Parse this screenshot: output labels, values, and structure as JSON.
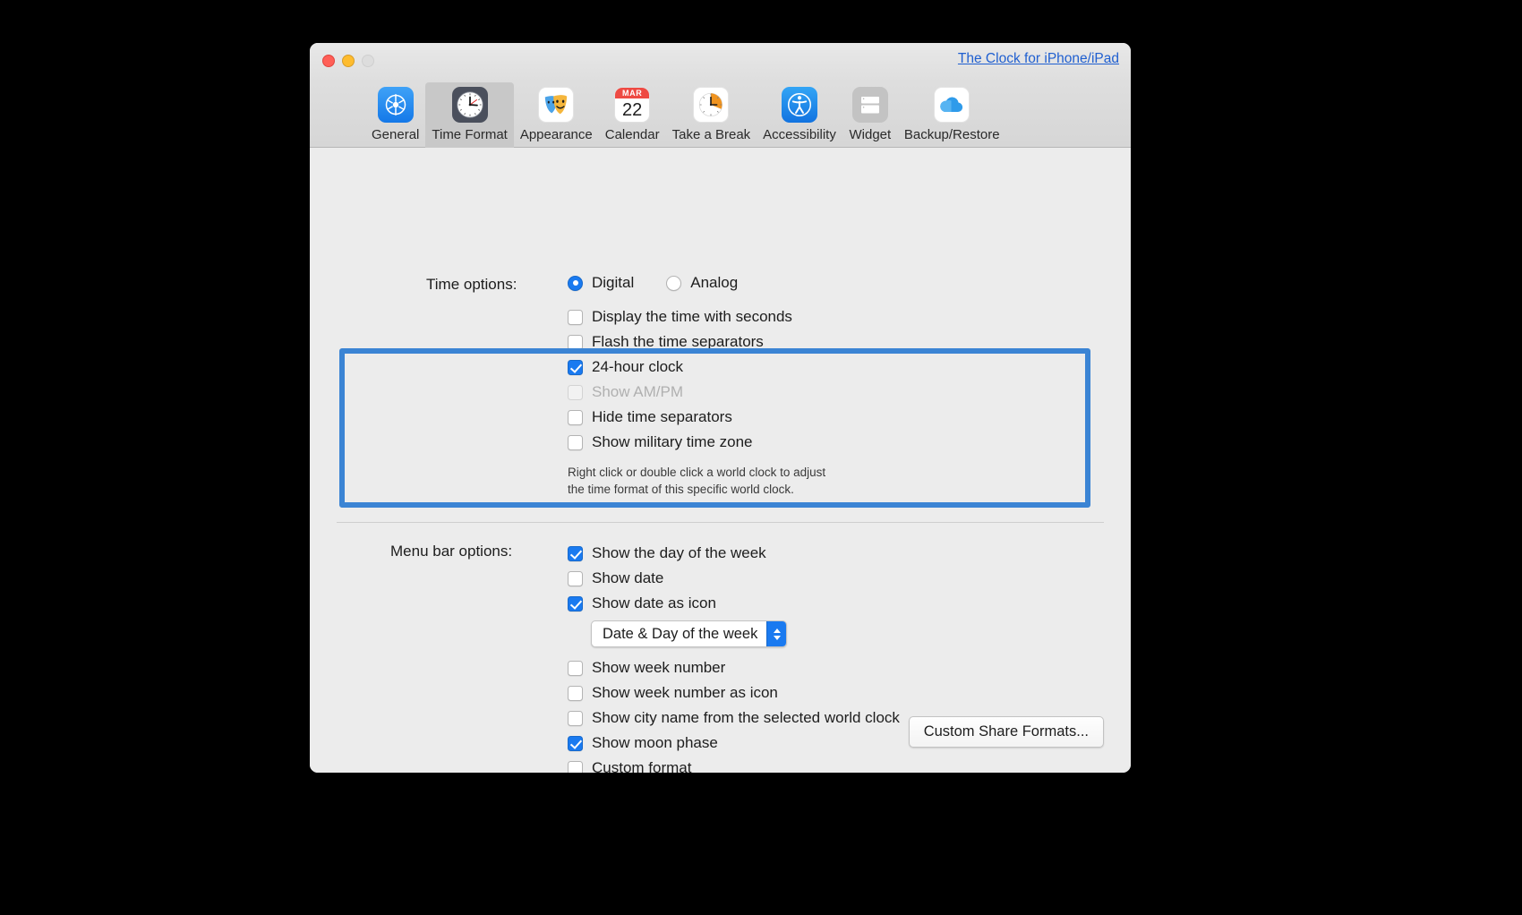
{
  "window": {
    "traffic_lights": [
      "close",
      "minimize",
      "zoom"
    ],
    "promo_link": "The Clock for iPhone/iPad"
  },
  "toolbar": {
    "items": [
      {
        "label": "General",
        "icon": "gear-icon",
        "selected": false
      },
      {
        "label": "Time Format",
        "icon": "clock-icon",
        "selected": true
      },
      {
        "label": "Appearance",
        "icon": "theater-masks-icon",
        "selected": false
      },
      {
        "label": "Calendar",
        "icon": "calendar-icon",
        "selected": false
      },
      {
        "label": "Take a Break",
        "icon": "timer-icon",
        "selected": false
      },
      {
        "label": "Accessibility",
        "icon": "accessibility-icon",
        "selected": false
      },
      {
        "label": "Widget",
        "icon": "widget-icon",
        "selected": false
      },
      {
        "label": "Backup/Restore",
        "icon": "cloud-icon",
        "selected": false
      }
    ],
    "calendar_icon": {
      "month": "MAR",
      "day": "22"
    }
  },
  "time_options": {
    "label": "Time options:",
    "radios": [
      {
        "label": "Digital",
        "selected": true
      },
      {
        "label": "Analog",
        "selected": false
      }
    ],
    "checkboxes": [
      {
        "label": "Display the time with seconds",
        "checked": false,
        "disabled": false
      },
      {
        "label": "Flash the time separators",
        "checked": false,
        "disabled": false
      },
      {
        "label": "24-hour clock",
        "checked": true,
        "disabled": false
      },
      {
        "label": "Show AM/PM",
        "checked": false,
        "disabled": true
      },
      {
        "label": "Hide time separators",
        "checked": false,
        "disabled": false
      },
      {
        "label": "Show military time zone",
        "checked": false,
        "disabled": false
      }
    ],
    "hint_line1": "Right click or double click a world clock to adjust",
    "hint_line2": "the time format of this specific world clock."
  },
  "menu_bar_options": {
    "label": "Menu bar options:",
    "checkboxes_top": [
      {
        "label": "Show the day of the week",
        "checked": true
      },
      {
        "label": "Show date",
        "checked": false
      },
      {
        "label": "Show date as icon",
        "checked": true
      }
    ],
    "date_format_popup": {
      "value": "Date & Day of the week"
    },
    "checkboxes_bottom": [
      {
        "label": "Show week number",
        "checked": false
      },
      {
        "label": "Show week number as icon",
        "checked": false
      },
      {
        "label": "Show city name from the selected world clock",
        "checked": false
      },
      {
        "label": "Show moon phase",
        "checked": true
      },
      {
        "label": "Custom format",
        "checked": false
      }
    ]
  },
  "footer": {
    "custom_share_formats_button": "Custom Share Formats..."
  },
  "colors": {
    "accent": "#1a7af0",
    "highlight_border": "#3b84d4",
    "link": "#1f5fd0",
    "window_bg": "#ececec"
  }
}
